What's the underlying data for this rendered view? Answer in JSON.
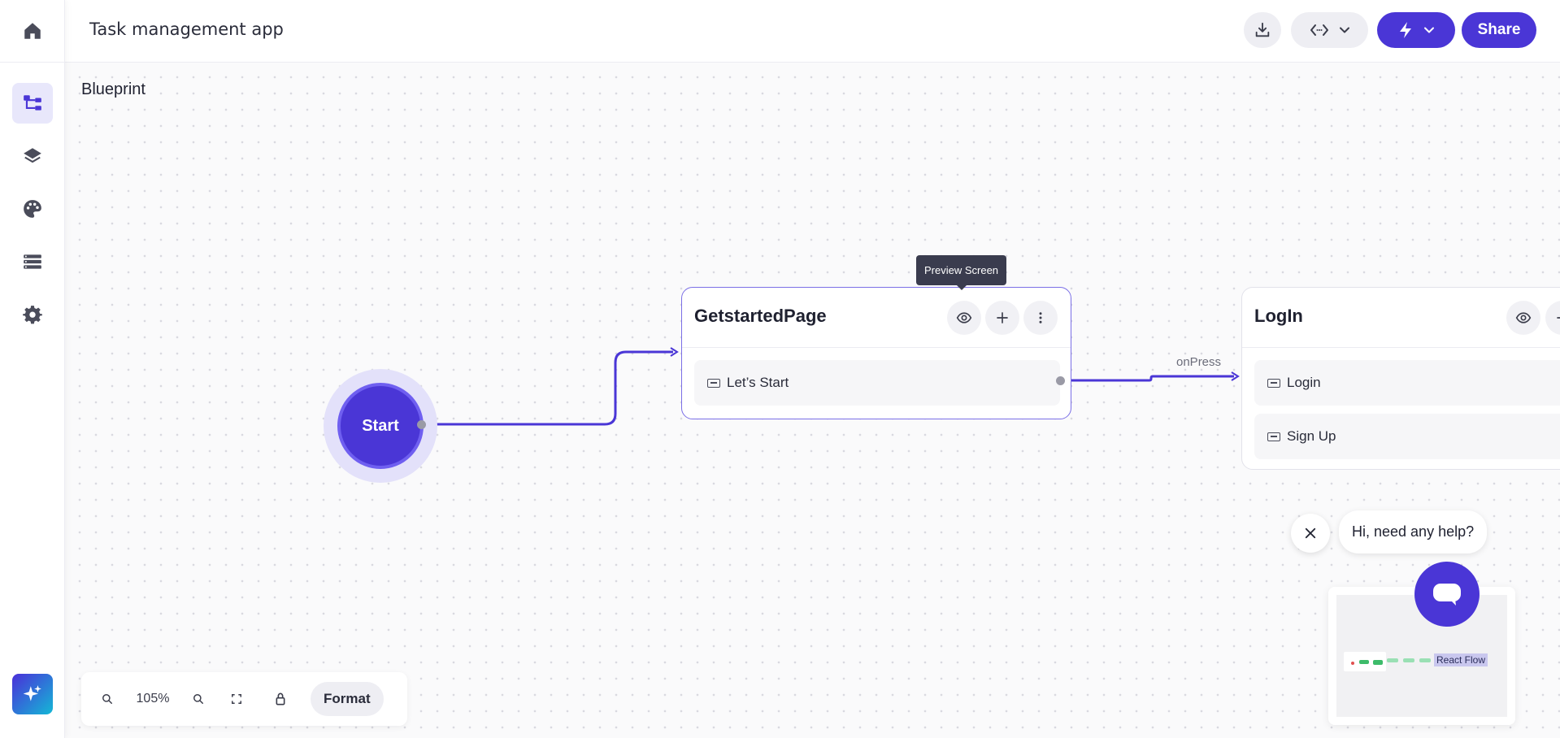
{
  "app": {
    "title": "Task management app"
  },
  "header": {
    "share_label": "Share"
  },
  "canvas": {
    "section_title": "Blueprint"
  },
  "flow": {
    "start_label": "Start",
    "nodes": [
      {
        "title": "GetstartedPage",
        "rows": [
          "Let’s Start"
        ]
      },
      {
        "title": "LogIn",
        "rows": [
          "Login",
          "Sign Up"
        ]
      }
    ],
    "edge_label": "onPress",
    "tooltip": "Preview Screen"
  },
  "controls": {
    "zoom_level": "105%",
    "format_label": "Format"
  },
  "help": {
    "message": "Hi, need any help?"
  },
  "attribution": "React Flow",
  "colors": {
    "accent": "#4a36d6",
    "accent_light": "#e3e1fa",
    "edge": "#4a36d6"
  },
  "icons": {
    "sidebar": [
      "home-icon",
      "blueprint-icon",
      "layers-icon",
      "palette-icon",
      "database-icon",
      "settings-icon",
      "ai-sparkle-icon"
    ],
    "header": [
      "download-icon",
      "code-icon",
      "chevron-down-icon",
      "lightning-icon",
      "chevron-down-icon"
    ],
    "node": [
      "eye-icon",
      "plus-icon",
      "more-vertical-icon"
    ],
    "controls": [
      "zoom-out-icon",
      "zoom-in-icon",
      "fit-view-icon",
      "lock-icon"
    ],
    "chat": [
      "close-icon",
      "chat-icon"
    ]
  }
}
